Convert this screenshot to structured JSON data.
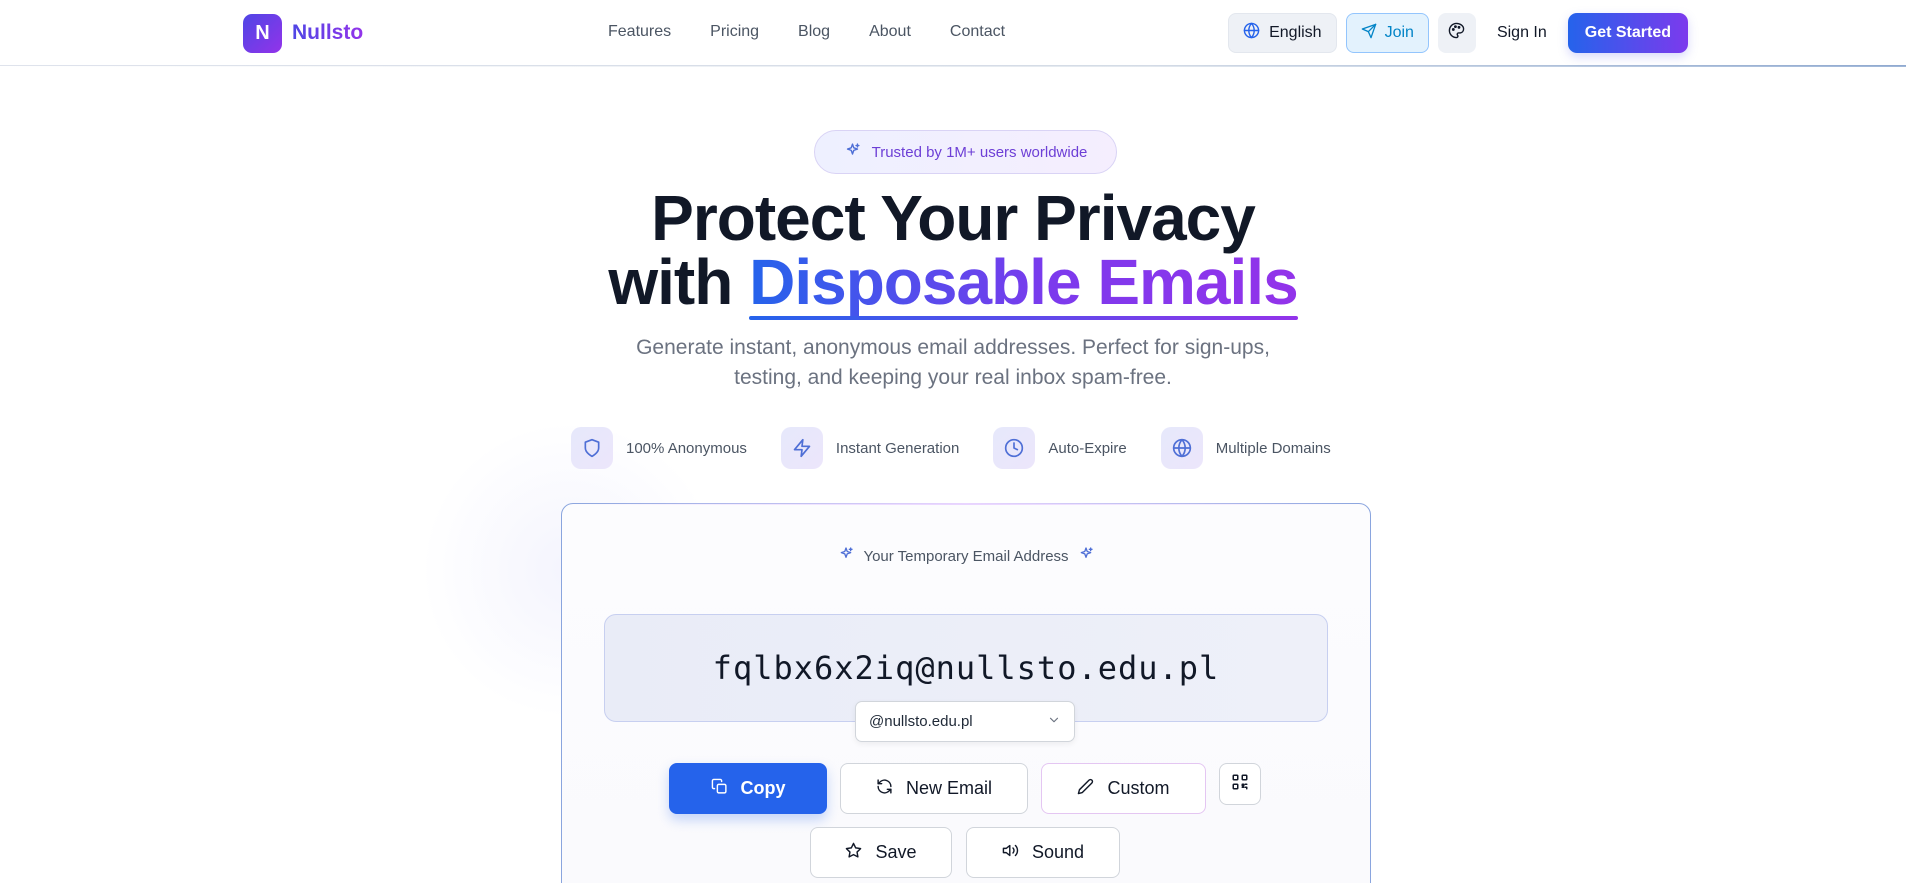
{
  "brand": {
    "mark": "N",
    "name": "Nullsto"
  },
  "nav": {
    "items": [
      {
        "label": "Features"
      },
      {
        "label": "Pricing"
      },
      {
        "label": "Blog"
      },
      {
        "label": "About"
      },
      {
        "label": "Contact"
      }
    ]
  },
  "header": {
    "language_label": "English",
    "join_label": "Join",
    "signin_label": "Sign In",
    "get_started_label": "Get Started"
  },
  "hero": {
    "trust_badge": "Trusted by 1M+ users worldwide",
    "title_line1": "Protect Your Privacy",
    "title_line2_prefix": "with ",
    "title_line2_highlight": "Disposable Emails",
    "subtitle_line1": "Generate instant, anonymous email addresses. Perfect for sign-ups,",
    "subtitle_line2": "testing, and keeping your real inbox spam-free."
  },
  "features": [
    {
      "icon": "shield-icon",
      "label": "100% Anonymous"
    },
    {
      "icon": "lightning-icon",
      "label": "Instant Generation"
    },
    {
      "icon": "clock-icon",
      "label": "Auto-Expire"
    },
    {
      "icon": "globe-icon",
      "label": "Multiple Domains"
    }
  ],
  "email_card": {
    "label": "Your Temporary Email Address",
    "email": "fqlbx6x2iq@nullsto.edu.pl",
    "domain_selected": "@nullsto.edu.pl",
    "actions": {
      "copy": "Copy",
      "new_email": "New Email",
      "custom": "Custom",
      "save": "Save",
      "sound": "Sound"
    }
  },
  "colors": {
    "primary": "#2563eb",
    "accent_purple": "#9333ea",
    "text_dark": "#111827",
    "text_muted": "#6b7280"
  }
}
